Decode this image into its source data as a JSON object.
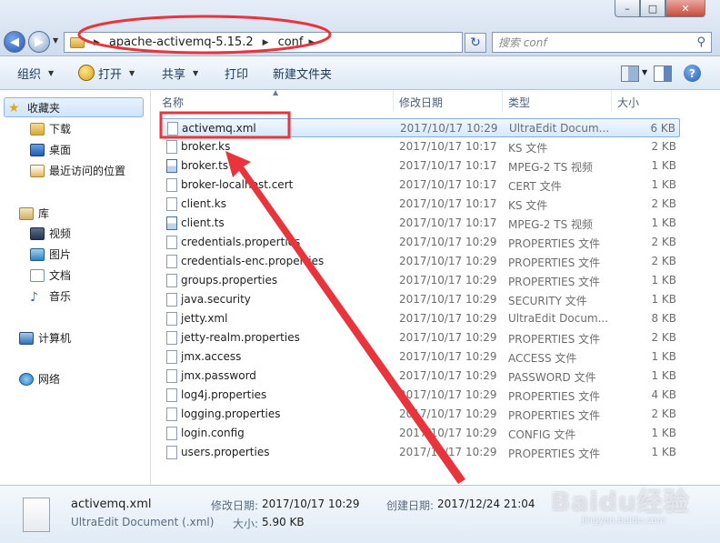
{
  "window": {
    "minimize": "–",
    "maximize": "□",
    "close": "✕"
  },
  "address": {
    "crumbs": [
      "apache-activemq-5.15.2",
      "conf"
    ],
    "search_placeholder": "搜索 conf"
  },
  "toolbar": {
    "organize": "组织",
    "open": "打开",
    "share": "共享",
    "print": "打印",
    "new_folder": "新建文件夹"
  },
  "nav": {
    "favorites": "收藏夹",
    "downloads": "下载",
    "desktop": "桌面",
    "recent": "最近访问的位置",
    "libraries": "库",
    "videos": "视频",
    "pictures": "图片",
    "documents": "文档",
    "music": "音乐",
    "computer": "计算机",
    "network": "网络"
  },
  "columns": {
    "name": "名称",
    "date": "修改日期",
    "type": "类型",
    "size": "大小"
  },
  "files": [
    {
      "name": "activemq.xml",
      "date": "2017/10/17 10:29",
      "type": "UltraEdit Docum...",
      "size": "6 KB",
      "icon": "document-icon"
    },
    {
      "name": "broker.ks",
      "date": "2017/10/17 10:17",
      "type": "KS 文件",
      "size": "2 KB",
      "icon": "document-icon"
    },
    {
      "name": "broker.ts",
      "date": "2017/10/17 10:17",
      "type": "MPEG-2 TS 视频",
      "size": "1 KB",
      "icon": "video-file-icon"
    },
    {
      "name": "broker-localhost.cert",
      "date": "2017/10/17 10:17",
      "type": "CERT 文件",
      "size": "1 KB",
      "icon": "document-icon"
    },
    {
      "name": "client.ks",
      "date": "2017/10/17 10:17",
      "type": "KS 文件",
      "size": "2 KB",
      "icon": "document-icon"
    },
    {
      "name": "client.ts",
      "date": "2017/10/17 10:17",
      "type": "MPEG-2 TS 视频",
      "size": "1 KB",
      "icon": "video-file-icon"
    },
    {
      "name": "credentials.properties",
      "date": "2017/10/17 10:29",
      "type": "PROPERTIES 文件",
      "size": "2 KB",
      "icon": "document-icon"
    },
    {
      "name": "credentials-enc.properties",
      "date": "2017/10/17 10:29",
      "type": "PROPERTIES 文件",
      "size": "2 KB",
      "icon": "document-icon"
    },
    {
      "name": "groups.properties",
      "date": "2017/10/17 10:29",
      "type": "PROPERTIES 文件",
      "size": "1 KB",
      "icon": "document-icon"
    },
    {
      "name": "java.security",
      "date": "2017/10/17 10:29",
      "type": "SECURITY 文件",
      "size": "1 KB",
      "icon": "document-icon"
    },
    {
      "name": "jetty.xml",
      "date": "2017/10/17 10:29",
      "type": "UltraEdit Docum...",
      "size": "8 KB",
      "icon": "document-icon"
    },
    {
      "name": "jetty-realm.properties",
      "date": "2017/10/17 10:29",
      "type": "PROPERTIES 文件",
      "size": "2 KB",
      "icon": "document-icon"
    },
    {
      "name": "jmx.access",
      "date": "2017/10/17 10:29",
      "type": "ACCESS 文件",
      "size": "1 KB",
      "icon": "document-icon"
    },
    {
      "name": "jmx.password",
      "date": "2017/10/17 10:29",
      "type": "PASSWORD 文件",
      "size": "1 KB",
      "icon": "document-icon"
    },
    {
      "name": "log4j.properties",
      "date": "2017/10/17 10:29",
      "type": "PROPERTIES 文件",
      "size": "4 KB",
      "icon": "document-icon"
    },
    {
      "name": "logging.properties",
      "date": "2017/10/17 10:29",
      "type": "PROPERTIES 文件",
      "size": "2 KB",
      "icon": "document-icon"
    },
    {
      "name": "login.config",
      "date": "2017/10/17 10:29",
      "type": "CONFIG 文件",
      "size": "1 KB",
      "icon": "document-icon"
    },
    {
      "name": "users.properties",
      "date": "2017/10/17 10:29",
      "type": "PROPERTIES 文件",
      "size": "1 KB",
      "icon": "document-icon"
    }
  ],
  "details": {
    "name": "activemq.xml",
    "type": "UltraEdit Document (.xml)",
    "modified_label": "修改日期:",
    "modified": "2017/10/17 10:29",
    "created_label": "创建日期:",
    "created": "2017/12/24 21:04",
    "size_label": "大小:",
    "size": "5.90 KB"
  },
  "watermark": {
    "text": "Baidu经验",
    "url": "jingyan.baidu.com"
  },
  "colors": {
    "annotation_red": "#e8343a",
    "selection": "#d6e8fc"
  }
}
